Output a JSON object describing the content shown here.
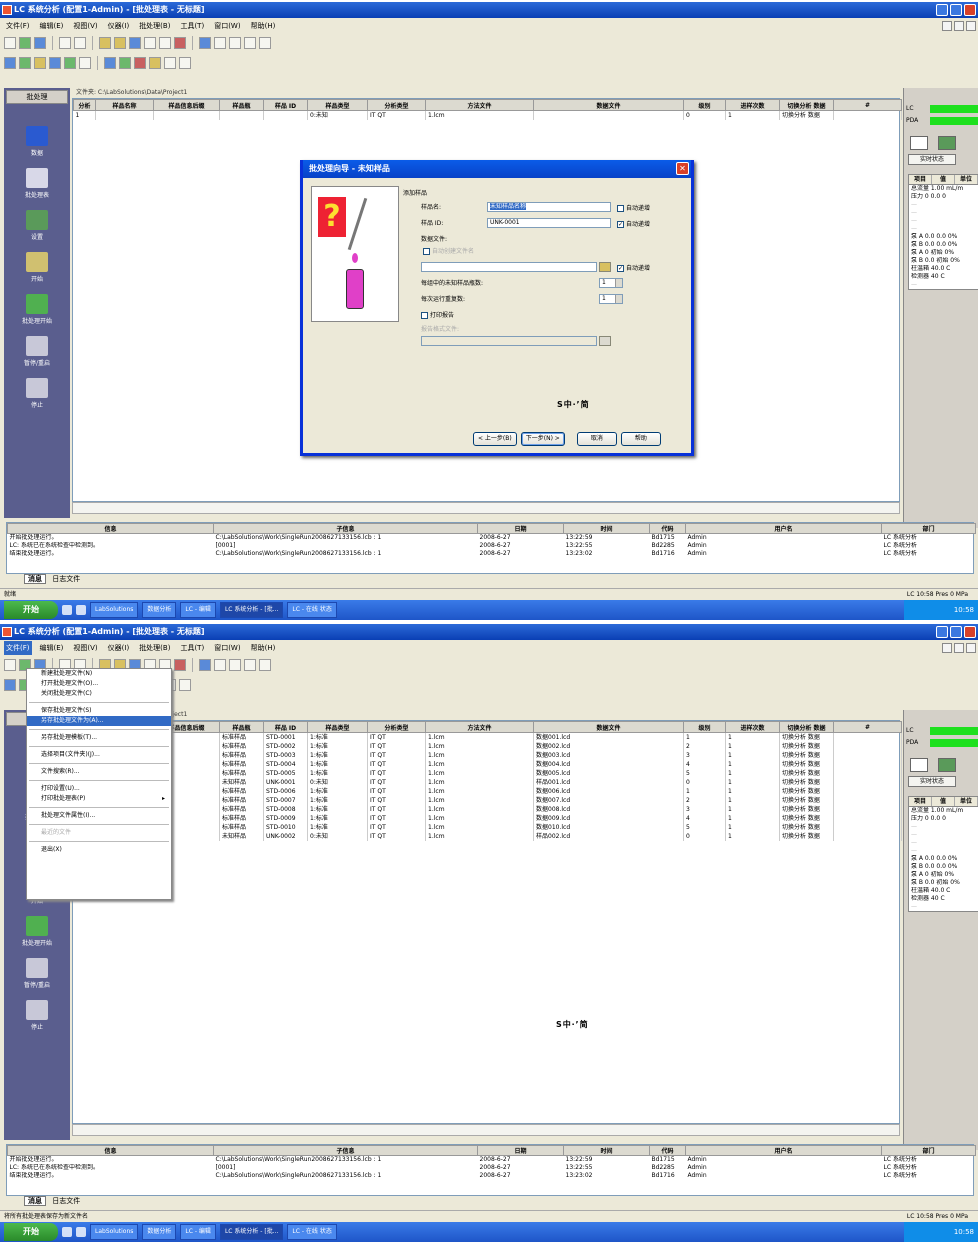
{
  "window": {
    "title": "LC 系统分析 (配置1-Admin) - [批处理表 - 无标题]",
    "menu": [
      "文件(F)",
      "编辑(E)",
      "视图(V)",
      "仪器(I)",
      "批处理(B)",
      "工具(T)",
      "窗口(W)",
      "帮助(H)"
    ]
  },
  "sidebar": {
    "header": "批处理",
    "items": [
      {
        "label": "数据",
        "icon": "phone-icon",
        "color": "#2a5ad0"
      },
      {
        "label": "批处理表",
        "icon": "pencil-icon",
        "color": "#d8d8e8"
      },
      {
        "label": "设置",
        "icon": "settings-icon",
        "color": "#5a9a5a"
      },
      {
        "label": "开始",
        "icon": "run-icon",
        "color": "#d0c070"
      },
      {
        "label": "批处理开始",
        "icon": "play-icon",
        "color": "#50b050"
      },
      {
        "label": "暂停/重启",
        "icon": "pause-icon",
        "color": "#c8c8d8"
      },
      {
        "label": "停止",
        "icon": "stop-icon",
        "color": "#c8c8d8"
      }
    ]
  },
  "path_label": "文件夹: C:\\LabSolutions\\Data\\Project1",
  "grid": {
    "columns": [
      "分析",
      "样品名称",
      "样品信息后缀",
      "样品瓶",
      "样品 ID",
      "样品类型",
      "分析类型",
      "方法文件",
      "数据文件",
      "级别",
      "进样次数",
      "切换分析 数据",
      "#"
    ],
    "screen1_rows": [
      [
        "1",
        "",
        "",
        "",
        "",
        "0:未知",
        "IT QT",
        "1.lcm",
        "",
        "0",
        "1",
        "切换分析 数据",
        ""
      ]
    ],
    "screen2_rows": [
      [
        "",
        "",
        "",
        "标准样品",
        "STD-0001",
        "1:标准",
        "IT QT",
        "1.lcm",
        "数据001.lcd",
        "1",
        "1",
        "切换分析 数据",
        ""
      ],
      [
        "",
        "",
        "",
        "标准样品",
        "STD-0002",
        "1:标准",
        "IT QT",
        "1.lcm",
        "数据002.lcd",
        "2",
        "1",
        "切换分析 数据",
        ""
      ],
      [
        "",
        "",
        "",
        "标准样品",
        "STD-0003",
        "1:标准",
        "IT QT",
        "1.lcm",
        "数据003.lcd",
        "3",
        "1",
        "切换分析 数据",
        ""
      ],
      [
        "",
        "",
        "",
        "标准样品",
        "STD-0004",
        "1:标准",
        "IT QT",
        "1.lcm",
        "数据004.lcd",
        "4",
        "1",
        "切换分析 数据",
        ""
      ],
      [
        "",
        "",
        "",
        "标准样品",
        "STD-0005",
        "1:标准",
        "IT QT",
        "1.lcm",
        "数据005.lcd",
        "5",
        "1",
        "切换分析 数据",
        ""
      ],
      [
        "",
        "",
        "",
        "未知样品",
        "UNK-0001",
        "0:未知",
        "IT QT",
        "1.lcm",
        "样品001.lcd",
        "0",
        "1",
        "切换分析 数据",
        ""
      ],
      [
        "",
        "",
        "",
        "标准样品",
        "STD-0006",
        "1:标准",
        "IT QT",
        "1.lcm",
        "数据006.lcd",
        "1",
        "1",
        "切换分析 数据",
        ""
      ],
      [
        "",
        "",
        "",
        "标准样品",
        "STD-0007",
        "1:标准",
        "IT QT",
        "1.lcm",
        "数据007.lcd",
        "2",
        "1",
        "切换分析 数据",
        ""
      ],
      [
        "",
        "",
        "",
        "标准样品",
        "STD-0008",
        "1:标准",
        "IT QT",
        "1.lcm",
        "数据008.lcd",
        "3",
        "1",
        "切换分析 数据",
        ""
      ],
      [
        "",
        "",
        "",
        "标准样品",
        "STD-0009",
        "1:标准",
        "IT QT",
        "1.lcm",
        "数据009.lcd",
        "4",
        "1",
        "切换分析 数据",
        ""
      ],
      [
        "",
        "",
        "",
        "标准样品",
        "STD-0010",
        "1:标准",
        "IT QT",
        "1.lcm",
        "数据010.lcd",
        "5",
        "1",
        "切换分析 数据",
        ""
      ],
      [
        "",
        "",
        "",
        "未知样品",
        "UNK-0002",
        "0:未知",
        "IT QT",
        "1.lcm",
        "样品002.lcd",
        "0",
        "1",
        "切换分析 数据",
        ""
      ]
    ]
  },
  "right_panel": {
    "lc_label": "LC",
    "pda_label": "PDA",
    "tab_label": "实时状态",
    "table_headers": [
      "项目",
      "值",
      "单位"
    ],
    "lines": [
      "总流量 1.00 mL/m",
      "压力 0 0.0 0",
      "泵 A 0.0 0.0 0%",
      "泵 B 0.0 0.0 0%",
      "泵 A 0 初始 0%",
      "泵 B 0.0 初始 0%",
      "柱温箱 40.0 C",
      "检测器 40 C"
    ],
    "dim_lines": [
      "—",
      "—",
      "—",
      "—",
      "—"
    ]
  },
  "log": {
    "columns": [
      "信息",
      "子信息",
      "日期",
      "时间",
      "代码",
      "用户名",
      "部门"
    ],
    "rows": [
      [
        "开始批处理运行。",
        "C:\\LabSolutions\\Work\\SingleRun2008627133156.lcb : 1",
        "2008-6-27",
        "13:22:59",
        "Bd1715",
        "Admin",
        "LC 系统分析"
      ],
      [
        "LC: 系统已在系统检查中检测到。",
        "[0001]",
        "2008-6-27",
        "13:22:55",
        "Bd2285",
        "Admin",
        "LC 系统分析"
      ],
      [
        "结束批处理运行。",
        "C:\\LabSolutions\\Work\\SingleRun2008627133156.lcb : 1",
        "2008-6-27",
        "13:23:02",
        "Bd1716",
        "Admin",
        "LC 系统分析"
      ]
    ],
    "tabs": [
      "消息",
      "日志文件"
    ]
  },
  "status": {
    "left1": "就绪",
    "left2": "将所有批处理表保存为新文件名",
    "right": "LC 10:58 Pres 0 MPa"
  },
  "taskbar": {
    "start": "开始",
    "buttons": [
      "LabSolutions",
      "数据分析",
      "LC - 编辑",
      "LC 系统分析 - [批...",
      "LC - 在线 状态"
    ],
    "clock": "10:58"
  },
  "dialog": {
    "title": "批处理向导 - 未知样品",
    "group_label": "添加样品",
    "sample_name_label": "样品名:",
    "sample_name_value": "未知样品名称",
    "sample_id_label": "样品 ID:",
    "sample_id_value": "UNK-0001",
    "data_file_label": "数据文件:",
    "auto_filename_label": "自动创建文件名",
    "auto_increment_1": "自动递增",
    "auto_increment_2": "自动递增",
    "auto_increment_3": "自动递增",
    "vial_count_label": "每组中的未知样品瓶数:",
    "vial_count_value": "1",
    "repeat_label": "每次运行重复数:",
    "repeat_value": "1",
    "print_label": "打印报告",
    "report_format_label": "报告格式文件:",
    "buttons": [
      "< 上一步(B)",
      "下一步(N) >",
      "取消",
      "帮助"
    ]
  },
  "ime_bar": "S中‧’简",
  "dropdown": {
    "items": [
      {
        "label": "新建批处理文件(N)",
        "sep": false
      },
      {
        "label": "打开批处理文件(O)...",
        "sep": false
      },
      {
        "label": "关闭批处理文件(C)",
        "sep": true
      },
      {
        "label": "保存批处理文件(S)",
        "sep": false
      },
      {
        "label": "另存批处理文件为(A)...",
        "sep": true,
        "hl": true
      },
      {
        "label": "另存批处理模板(T)...",
        "sep": true
      },
      {
        "label": "选择项目(文件夹)(J)...",
        "sep": true
      },
      {
        "label": "文件搜索(R)...",
        "sep": true
      },
      {
        "label": "打印设置(U)...",
        "sep": false
      },
      {
        "label": "打印批处理表(P)",
        "sep": true,
        "arrow": true
      },
      {
        "label": "批处理文件属性(I)...",
        "sep": true
      },
      {
        "label": "最近的文件",
        "sep": true,
        "dis": true
      },
      {
        "label": "退出(X)",
        "sep": false
      }
    ]
  }
}
